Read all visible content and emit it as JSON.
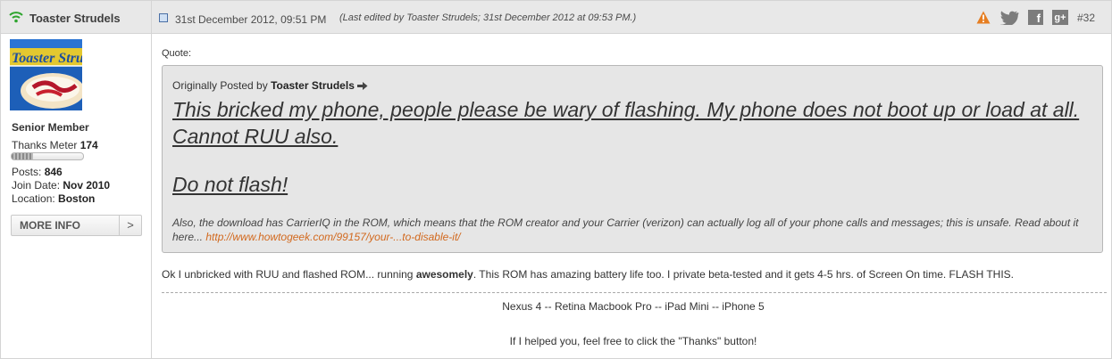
{
  "header": {
    "username": "Toaster Strudels",
    "date": "31st December 2012, 09:51 PM",
    "edited": "(Last edited by Toaster Strudels; 31st December 2012 at 09:53 PM.)",
    "post_number": "#32",
    "icons": [
      "online-icon",
      "post-icon",
      "warning-icon",
      "twitter-icon",
      "facebook-icon",
      "google-plus-icon"
    ]
  },
  "user": {
    "avatar_text": "Toaster Strudel",
    "title": "Senior Member",
    "thanks_label": "Thanks Meter",
    "thanks_value": "174",
    "thanks_level": 0.3,
    "posts_label": "Posts:",
    "posts_value": "846",
    "join_label": "Join Date:",
    "join_value": "Nov 2010",
    "location_label": "Location:",
    "location_value": "Boston",
    "more_info": "MORE INFO",
    "more_arrow": ">"
  },
  "post": {
    "quote_label": "Quote:",
    "quote": {
      "orig_prefix": "Originally Posted by",
      "orig_author": "Toaster Strudels",
      "big_line1": "This bricked my phone, people please be wary of flashing. My phone does not boot up or load at all. Cannot RUU also.",
      "big_line2": "Do not flash!",
      "small_text": "Also, the download has CarrierIQ in the ROM, which means that the ROM creator and your Carrier (verizon) can actually log all of your phone calls and messages; this is unsafe. Read about it here...",
      "link": "http://www.howtogeek.com/99157/your-...to-disable-it/"
    },
    "body_pre": "Ok I unbricked with RUU and flashed ROM... running",
    "body_bold": "awesomely",
    "body_post": ". This ROM has amazing battery life too. I private beta-tested and it gets 4-5 hrs. of Screen On time. FLASH THIS.",
    "sig_line1": "Nexus 4 -- Retina Macbook Pro -- iPad Mini -- iPhone 5",
    "sig_line2": "If I helped you, feel free to click the \"Thanks\" button!"
  },
  "colors": {
    "header_bg": "#e8e8e8",
    "quote_bg": "#e6e6e6",
    "link": "#d2691e",
    "online": "#2ea52e",
    "warning": "#e67e22"
  }
}
